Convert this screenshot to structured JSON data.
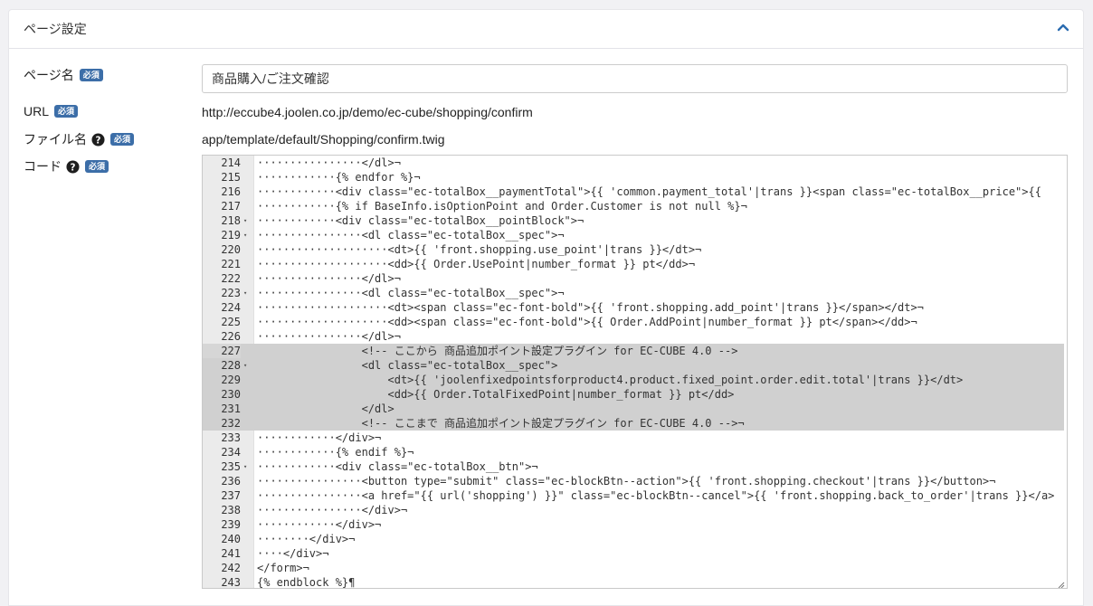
{
  "section": {
    "title": "ページ設定"
  },
  "labels": {
    "page_name": "ページ名",
    "url": "URL",
    "file_name": "ファイル名",
    "code": "コード",
    "required": "必須"
  },
  "fields": {
    "page_name_value": "商品購入/ご注文確認",
    "url_value": "http://eccube4.joolen.co.jp/demo/ec-cube/shopping/confirm",
    "file_name_value": "app/template/default/Shopping/confirm.twig"
  },
  "icons": {
    "collapse": "chevron-up-icon",
    "help": "question-circle-icon"
  },
  "colors": {
    "accent": "#3c6ea8",
    "highlight": "#d0d0d0"
  },
  "editor": {
    "current_line": "227",
    "lines": [
      {
        "n": "214",
        "fold": "",
        "text": "················</dl>¬"
      },
      {
        "n": "215",
        "fold": "",
        "text": "············{% endfor %}¬"
      },
      {
        "n": "216",
        "fold": "",
        "text": "············<div class=\"ec-totalBox__paymentTotal\">{{ 'common.payment_total'|trans }}<span class=\"ec-totalBox__price\">{{"
      },
      {
        "n": "217",
        "fold": "",
        "text": "············{% if BaseInfo.isOptionPoint and Order.Customer is not null %}¬"
      },
      {
        "n": "218",
        "fold": "▾",
        "text": "············<div class=\"ec-totalBox__pointBlock\">¬"
      },
      {
        "n": "219",
        "fold": "▾",
        "text": "················<dl class=\"ec-totalBox__spec\">¬"
      },
      {
        "n": "220",
        "fold": "",
        "text": "····················<dt>{{ 'front.shopping.use_point'|trans }}</dt>¬"
      },
      {
        "n": "221",
        "fold": "",
        "text": "····················<dd>{{ Order.UsePoint|number_format }} pt</dd>¬"
      },
      {
        "n": "222",
        "fold": "",
        "text": "················</dl>¬"
      },
      {
        "n": "223",
        "fold": "▾",
        "text": "················<dl class=\"ec-totalBox__spec\">¬"
      },
      {
        "n": "224",
        "fold": "",
        "text": "····················<dt><span class=\"ec-font-bold\">{{ 'front.shopping.add_point'|trans }}</span></dt>¬"
      },
      {
        "n": "225",
        "fold": "",
        "text": "····················<dd><span class=\"ec-font-bold\">{{ Order.AddPoint|number_format }} pt</span></dd>¬"
      },
      {
        "n": "226",
        "fold": "",
        "text": "················</dl>¬"
      },
      {
        "n": "227",
        "fold": "",
        "text": "                <!-- ここから 商品追加ポイント設定プラグイン for EC-CUBE 4.0 -->",
        "hl": true
      },
      {
        "n": "228",
        "fold": "▾",
        "text": "                <dl class=\"ec-totalBox__spec\">",
        "hl": true
      },
      {
        "n": "229",
        "fold": "",
        "text": "                    <dt>{{ 'joolenfixedpointsforproduct4.product.fixed_point.order.edit.total'|trans }}</dt>",
        "hl": true
      },
      {
        "n": "230",
        "fold": "",
        "text": "                    <dd>{{ Order.TotalFixedPoint|number_format }} pt</dd>",
        "hl": true
      },
      {
        "n": "231",
        "fold": "",
        "text": "                </dl>",
        "hl": true
      },
      {
        "n": "232",
        "fold": "",
        "text": "                <!-- ここまで 商品追加ポイント設定プラグイン for EC-CUBE 4.0 -->¬",
        "hl": true
      },
      {
        "n": "233",
        "fold": "",
        "text": "············</div>¬"
      },
      {
        "n": "234",
        "fold": "",
        "text": "············{% endif %}¬"
      },
      {
        "n": "235",
        "fold": "▾",
        "text": "············<div class=\"ec-totalBox__btn\">¬"
      },
      {
        "n": "236",
        "fold": "",
        "text": "················<button type=\"submit\" class=\"ec-blockBtn--action\">{{ 'front.shopping.checkout'|trans }}</button>¬"
      },
      {
        "n": "237",
        "fold": "",
        "text": "················<a href=\"{{ url('shopping') }}\" class=\"ec-blockBtn--cancel\">{{ 'front.shopping.back_to_order'|trans }}</a>"
      },
      {
        "n": "238",
        "fold": "",
        "text": "················</div>¬"
      },
      {
        "n": "239",
        "fold": "",
        "text": "············</div>¬"
      },
      {
        "n": "240",
        "fold": "",
        "text": "········</div>¬"
      },
      {
        "n": "241",
        "fold": "",
        "text": "····</div>¬"
      },
      {
        "n": "242",
        "fold": "",
        "text": "</form>¬"
      },
      {
        "n": "243",
        "fold": "",
        "text": "{% endblock %}¶"
      }
    ]
  }
}
